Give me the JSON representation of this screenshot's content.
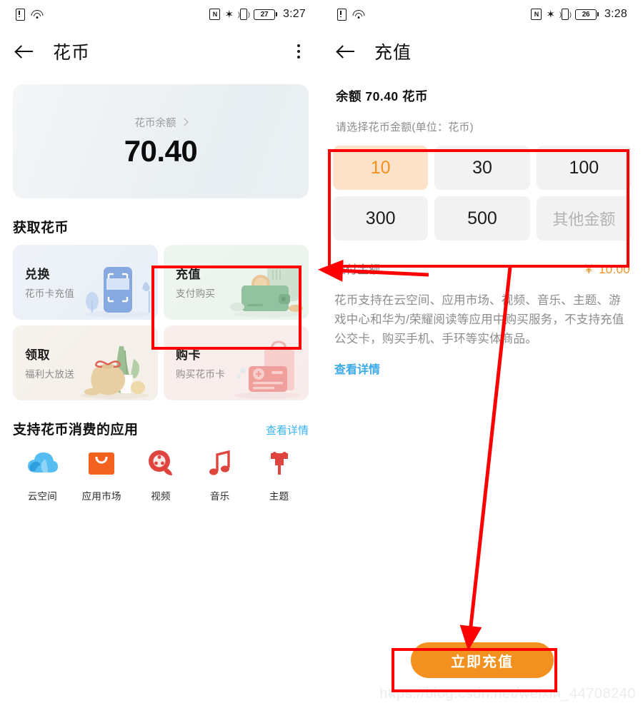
{
  "left_screen": {
    "status_bar": {
      "sim_icon": "sim-alert-icon",
      "wifi_icon": "wifi-icon",
      "nfc_icon": "nfc-icon",
      "nfc_glyph": "N",
      "bluetooth_icon": "bluetooth-icon",
      "bluetooth_glyph": "✶",
      "vibrate_icon": "vibrate-icon",
      "battery_level": "27",
      "time": "3:27"
    },
    "app_bar": {
      "back_icon": "back-arrow-icon",
      "title": "花币",
      "menu_icon": "kebab-menu-icon"
    },
    "balance_card": {
      "label": "花币余额",
      "chevron_icon": "chevron-right-icon",
      "value": "70.40"
    },
    "acquire_section": {
      "title": "获取花币",
      "cards": [
        {
          "title": "兑换",
          "subtitle": "花币卡充值",
          "theme": "blue",
          "art": "scanner-illustration"
        },
        {
          "title": "充值",
          "subtitle": "支付购买",
          "theme": "green",
          "art": "wallet-illustration"
        },
        {
          "title": "领取",
          "subtitle": "福利大放送",
          "theme": "beige",
          "art": "money-bag-illustration"
        },
        {
          "title": "购卡",
          "subtitle": "购买花币卡",
          "theme": "pink",
          "art": "gift-card-illustration"
        }
      ]
    },
    "apps_section": {
      "title": "支持花币消费的应用",
      "link": "查看详情",
      "apps": [
        {
          "name": "云空间",
          "icon": "cloud-icon",
          "color": "#3fb3ef"
        },
        {
          "name": "应用市场",
          "icon": "appgallery-bag-icon",
          "color": "#f4621f"
        },
        {
          "name": "视频",
          "icon": "video-reel-icon",
          "color": "#e0443f"
        },
        {
          "name": "音乐",
          "icon": "music-note-icon",
          "color": "#e0443f"
        },
        {
          "name": "主题",
          "icon": "theme-brush-icon",
          "color": "#e0443f"
        }
      ]
    }
  },
  "right_screen": {
    "status_bar": {
      "nfc_glyph": "N",
      "bluetooth_glyph": "✶",
      "battery_level": "26",
      "time": "3:28"
    },
    "app_bar": {
      "back_icon": "back-arrow-icon",
      "title": "充值"
    },
    "balance_line": "余额  70.40 花币",
    "amount_hint": "请选择花币金额(单位：花币)",
    "amount_options": [
      {
        "label": "10",
        "selected": true
      },
      {
        "label": "30",
        "selected": false
      },
      {
        "label": "100",
        "selected": false
      },
      {
        "label": "300",
        "selected": false
      },
      {
        "label": "500",
        "selected": false
      },
      {
        "label": "其他金额",
        "selected": false,
        "placeholder": true
      }
    ],
    "payable": {
      "label": "应付金额",
      "value": "￥ 10.00"
    },
    "description": "花币支持在云空间、应用市场、视频、音乐、主题、游戏中心和华为/荣耀阅读等应用中购买服务，不支持充值公交卡，购买手机、手环等实体商品。",
    "detail_link": "查看详情",
    "cta_button": "立即充值"
  },
  "watermark": "https://blog.csdn.net/weixin_44708240",
  "colors": {
    "accent_orange": "#f2911f",
    "selected_bg": "#fce2c8",
    "link_blue": "#3aa9e8",
    "annotation_red": "#fe0000"
  }
}
